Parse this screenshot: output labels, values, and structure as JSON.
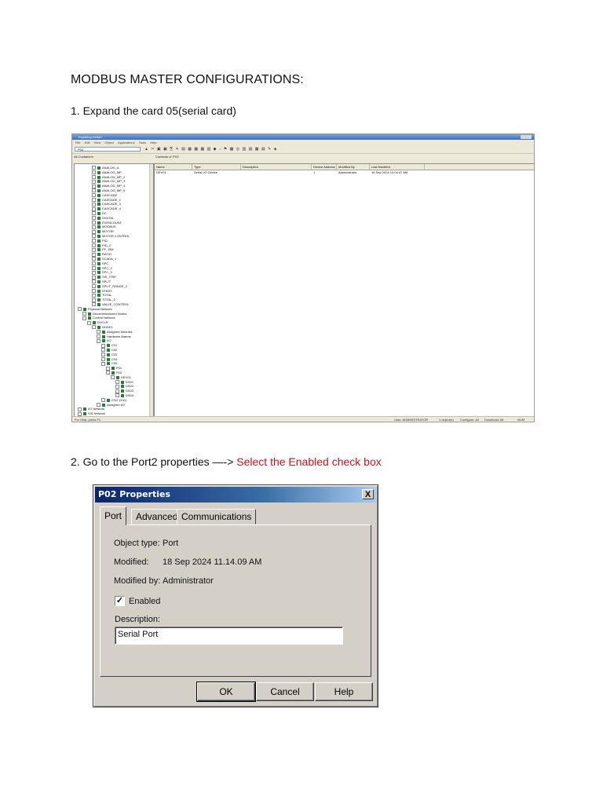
{
  "document": {
    "title": "MODBUS MASTER CONFIGURATIONS:",
    "step1": "1. Expand the card 05(serial card)",
    "step2_prefix": "2. Go to the Port2 properties —-> ",
    "step2_highlight": "Select the Enabled check box"
  },
  "explorer": {
    "window_title": "Exploring DeltaV",
    "menu": [
      "File",
      "Edit",
      "View",
      "Object",
      "Applications",
      "Tools",
      "Help"
    ],
    "location_combo": "P02",
    "all_containers_label": "All Containers",
    "contents_label": "Contents of 'P02'",
    "tree_items": [
      "ANALOG_A",
      "ANALOG_MP",
      "ANALOG_MP_2",
      "ANALOG_MP_3",
      "ANALOG_MP_4",
      "ANALOG_MP_5",
      "CASCADE",
      "CASCADE_2",
      "CASCADE_3",
      "CASCADE_4",
      "DC",
      "DIGITAL",
      "EVENCOUNT",
      "MODBUS",
      "MOTOR",
      "MOTOR CONTROL",
      "PID",
      "PID_2",
      "PF_SIM",
      "RATIO",
      "SCADA_1",
      "SPC",
      "SPC_2",
      "SPC_3",
      "SIS_TRIP",
      "SPLIT",
      "SPLIT_RANGE_2",
      "START",
      "TOTAL",
      "TOTAL_2",
      "VALVE_CONTROL",
      "Physical Network",
      "Decommissioned Nodes",
      "Control Network",
      "DVCLR",
      "NODE1",
      "Assigned Modules",
      "Hardware Alarms",
      "I/O",
      "C01",
      "C02",
      "C03",
      "C04",
      "C05",
      "P01",
      "P02",
      "DEV01",
      "DS01",
      "DS02",
      "DS03",
      "DS04",
      "CSI7 (S11)",
      "Assigned I/O",
      "I/O Network",
      "SIS Network"
    ],
    "columns": [
      "Name",
      "Type",
      "Description",
      "Device Address",
      "Modified By",
      "Last Modified"
    ],
    "rows": [
      {
        "name": "DEV01",
        "type": "Serial I/O Device",
        "description": "",
        "address": "1",
        "modified_by": "Administrator",
        "last_modified": "18 Sep 2024 10:04:47 AM"
      }
    ],
    "status_left": "For Help, press F1",
    "status_user": "User: ADMINISTRATOR",
    "status_objects": "1 object(s)",
    "status_configure": "Configure: All",
    "status_download": "Download: All",
    "status_num": "NUM"
  },
  "dialog": {
    "title": "P02 Properties",
    "close_glyph": "X",
    "tabs": [
      "Port",
      "Advanced",
      "Communications"
    ],
    "object_type_label": "Object type:",
    "object_type_value": "Port",
    "modified_label": "Modified:",
    "modified_value": "18 Sep 2024 11.14.09 AM",
    "modified_by_label": "Modified by:",
    "modified_by_value": "Administrator",
    "enabled_label": "Enabled",
    "enabled_checked": true,
    "check_glyph": "✓",
    "description_label": "Description:",
    "description_value": "Serial Port",
    "buttons": {
      "ok": "OK",
      "cancel": "Cancel",
      "help": "Help"
    }
  }
}
